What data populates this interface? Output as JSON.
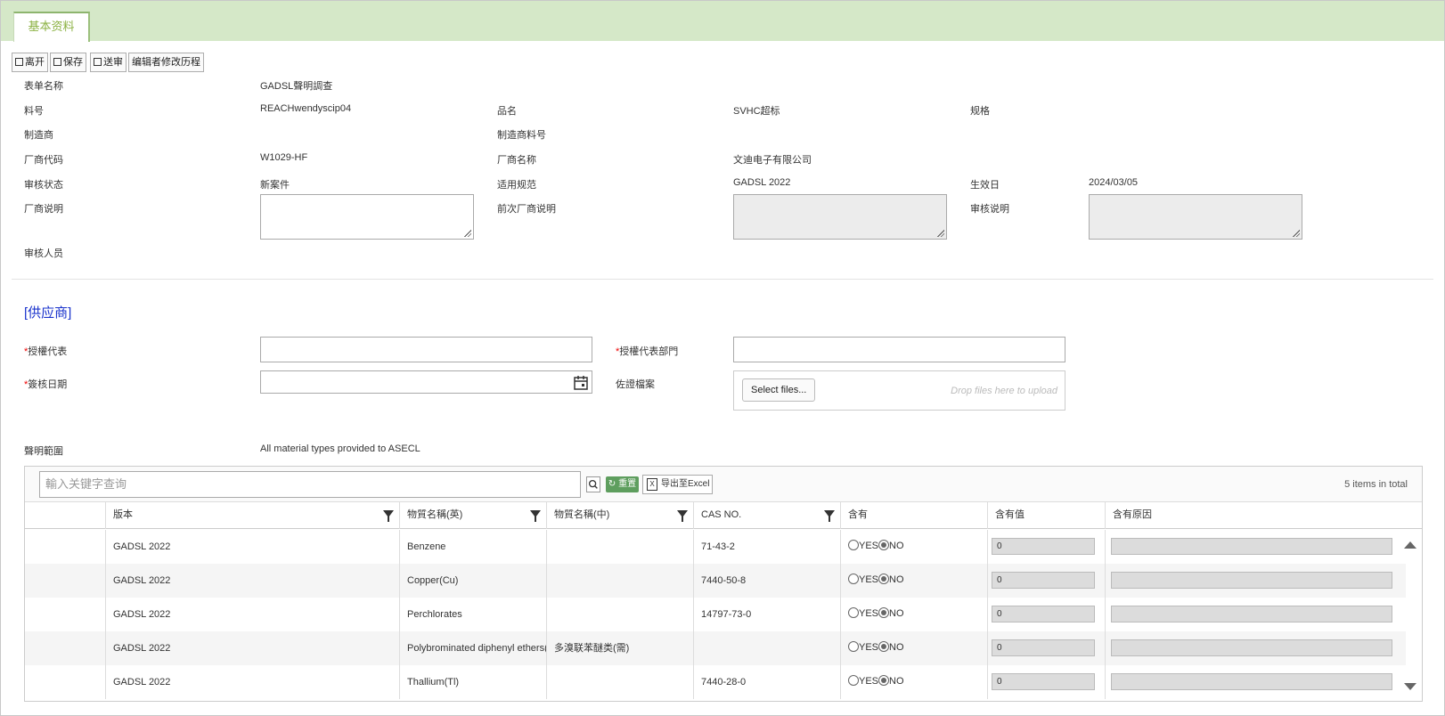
{
  "tab": {
    "label": "基本资料"
  },
  "toolbar": {
    "leave": "离开",
    "save": "保存",
    "submit": "送审",
    "history": "编辑者修改历程"
  },
  "info": {
    "form_name_label": "表单名称",
    "form_name": "GADSL聲明調查",
    "part_no_label": "料号",
    "part_no": "REACHwendyscip04",
    "product_name_label": "品名",
    "product_name": "SVHC超标",
    "spec_label": "规格",
    "manufacturer_label": "制造商",
    "mfr_part_no_label": "制造商料号",
    "vendor_code_label": "厂商代码",
    "vendor_code": "W1029-HF",
    "vendor_name_label": "厂商名称",
    "vendor_name": "文迪电子有限公司",
    "review_status_label": "审核状态",
    "review_status": "新案件",
    "applicable_spec_label": "适用规范",
    "applicable_spec": "GADSL 2022",
    "effective_date_label": "生效日",
    "effective_date": "2024/03/05",
    "vendor_note_label": "厂商说明",
    "prev_vendor_note_label": "前次厂商说明",
    "review_note_label": "审核说明",
    "reviewer_label": "审核人员"
  },
  "supplier": {
    "section_title": "[供应商]",
    "rep_label": "授權代表",
    "rep_dept_label": "授權代表部門",
    "sign_date_label": "簽核日期",
    "evidence_label": "佐證檔案",
    "select_files": "Select files...",
    "drop_hint": "Drop files here to upload",
    "scope_label": "聲明範圍",
    "scope": "All material types provided to ASECL"
  },
  "grid": {
    "search_placeholder": "輸入关键字查询",
    "reset": "重置",
    "export": "导出至Excel",
    "total": "5 items in total",
    "columns": [
      "版本",
      "物質名稱(英)",
      "物質名稱(中)",
      "CAS NO.",
      "含有",
      "含有值",
      "含有原因"
    ],
    "yes": "YES",
    "no": "NO",
    "rows": [
      {
        "version": "GADSL 2022",
        "name_en": "Benzene",
        "name_zh": "",
        "cas": "71-43-2",
        "contains": "NO",
        "value": "0"
      },
      {
        "version": "GADSL 2022",
        "name_en": "Copper(Cu)",
        "name_zh": "",
        "cas": "7440-50-8",
        "contains": "NO",
        "value": "0"
      },
      {
        "version": "GADSL 2022",
        "name_en": "Perchlorates",
        "name_zh": "",
        "cas": "14797-73-0",
        "contains": "NO",
        "value": "0"
      },
      {
        "version": "GADSL 2022",
        "name_en": "Polybrominated diphenyl ethers(",
        "name_zh": "多溴联苯醚类(需)",
        "cas": "",
        "contains": "NO",
        "value": "0"
      },
      {
        "version": "GADSL 2022",
        "name_en": "Thallium(Tl)",
        "name_zh": "",
        "cas": "7440-28-0",
        "contains": "NO",
        "value": "0"
      }
    ]
  }
}
